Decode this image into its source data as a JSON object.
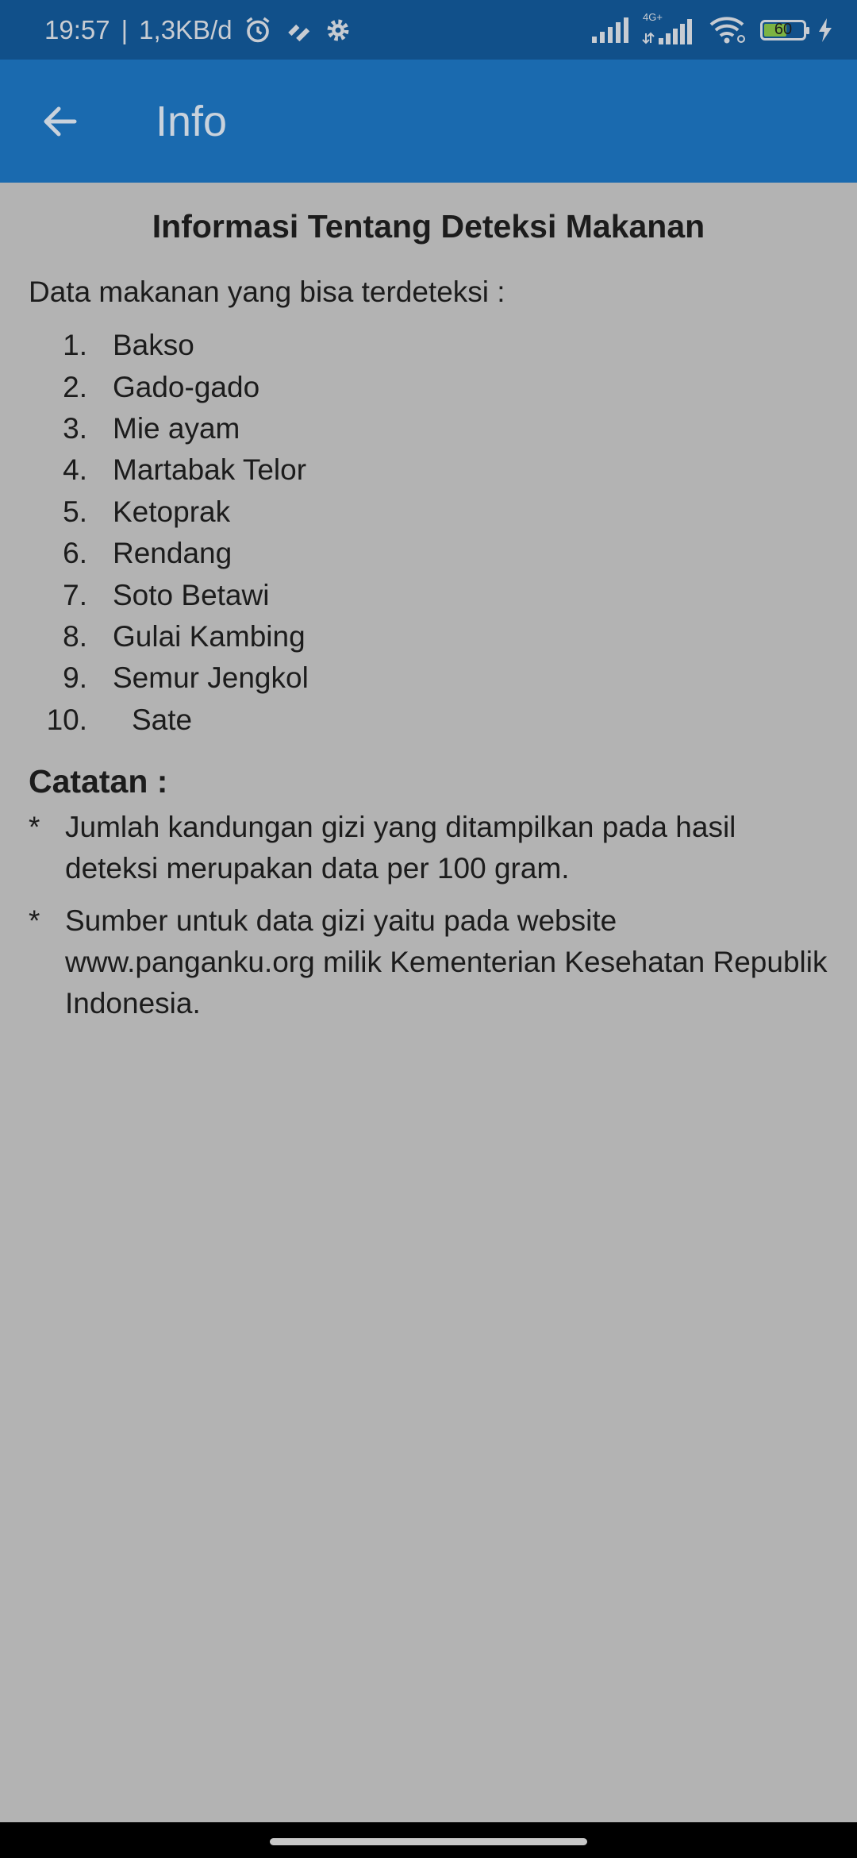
{
  "status_bar": {
    "time": "19:57",
    "separator": "|",
    "network_speed": "1,3KB/d",
    "network_type": "4G+",
    "battery_level": "60",
    "icons": [
      "alarm-icon",
      "hearts-icon",
      "gear-icon",
      "signal-icon",
      "signal-4g-icon",
      "wifi-icon",
      "battery-icon",
      "charging-icon"
    ]
  },
  "app_bar": {
    "title": "Info",
    "back_icon": "arrow-left-icon"
  },
  "main": {
    "heading": "Informasi Tentang Deteksi Makanan",
    "intro": "Data makanan yang bisa terdeteksi :",
    "foods": [
      {
        "num": "1.",
        "name": "Bakso"
      },
      {
        "num": "2.",
        "name": "Gado-gado"
      },
      {
        "num": "3.",
        "name": "Mie ayam"
      },
      {
        "num": "4.",
        "name": "Martabak Telor"
      },
      {
        "num": "5.",
        "name": "Ketoprak"
      },
      {
        "num": "6.",
        "name": "Rendang"
      },
      {
        "num": "7.",
        "name": "Soto Betawi"
      },
      {
        "num": "8.",
        "name": "Gulai Kambing"
      },
      {
        "num": "9.",
        "name": "Semur Jengkol"
      },
      {
        "num": "10.",
        "name": "Sate"
      }
    ],
    "notes_title": "Catatan :",
    "notes": [
      {
        "bullet": "*",
        "text": "Jumlah kandungan gizi yang ditampilkan pada hasil deteksi merupakan data per 100 gram."
      },
      {
        "bullet": "*",
        "text": "Sumber untuk data gizi yaitu pada website www.panganku.org milik Kementerian Kesehatan Republik Indonesia."
      }
    ]
  },
  "colors": {
    "status_bar": "#11508a",
    "app_bar": "#1a6aaf",
    "background": "#b3b3b3",
    "battery_fill": "#7cb342"
  }
}
